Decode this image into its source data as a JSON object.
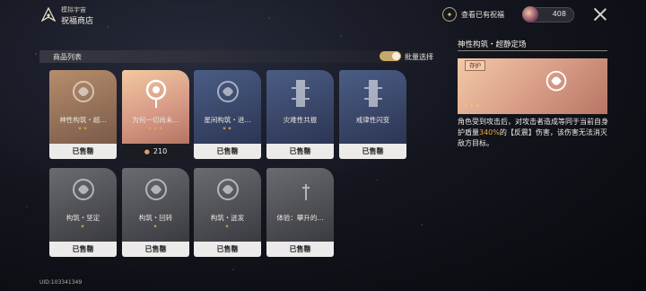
{
  "header": {
    "subtitle": "模拟宇宙",
    "title": "祝福商店",
    "view_blessings_label": "查看已有祝福",
    "currency_value": "408",
    "logo_icon": "universe-logo-icon",
    "close_icon": "close-icon"
  },
  "list": {
    "label": "商品列表",
    "batch_select_label": "批量选择",
    "batch_select_on": true
  },
  "cards": [
    {
      "name": "神性构筑・超...",
      "status": "已售罄",
      "rating": "✦✦",
      "theme": "orange"
    },
    {
      "name": "为何一切尚未...",
      "status": "210",
      "rating": "✦✦✦",
      "theme": "highlight"
    },
    {
      "name": "星间构筑・进...",
      "status": "已售罄",
      "rating": "✦✦",
      "theme": "blue"
    },
    {
      "name": "灾难性共振",
      "status": "已售罄",
      "rating": "",
      "theme": "blue"
    },
    {
      "name": "戒律性闪变",
      "status": "已售罄",
      "rating": "",
      "theme": "blue"
    },
    {
      "name": "构筑・坚定",
      "status": "已售罄",
      "rating": "✦",
      "theme": "gray"
    },
    {
      "name": "构筑・回转",
      "status": "已售罄",
      "rating": "✦",
      "theme": "gray"
    },
    {
      "name": "构筑・迸发",
      "status": "已售罄",
      "rating": "✦",
      "theme": "gray"
    },
    {
      "name": "体验：攀升的...",
      "status": "已售罄",
      "rating": "",
      "theme": "gray"
    }
  ],
  "panel": {
    "title": "神性构筑・超静定场",
    "tag": "存护",
    "stars": "✦✦✦",
    "desc_before": "角色受到攻击后，对攻击者造成等同于当前自身护盾量",
    "desc_highlight": "340%",
    "desc_after": "的【反震】伤害，该伤害无法消灭敌方目标。"
  },
  "footer": {
    "uid": "UID:103341349"
  },
  "colors": {
    "accent": "#f3a33a",
    "toggle": "#c8a76a",
    "sold_footer": "#ecebe9"
  }
}
